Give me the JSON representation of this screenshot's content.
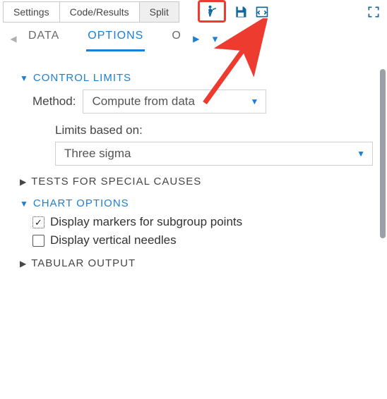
{
  "toolbar": {
    "settings": "Settings",
    "code_results": "Code/Results",
    "split": "Split"
  },
  "tabs": {
    "data": "DATA",
    "options": "OPTIONS",
    "truncated": "O"
  },
  "sections": {
    "control_limits": {
      "title": "CONTROL LIMITS",
      "method_label": "Method:",
      "method_value": "Compute from data",
      "limits_label": "Limits based on:",
      "limits_value": "Three sigma"
    },
    "tests_special": {
      "title": "TESTS FOR SPECIAL CAUSES"
    },
    "chart_options": {
      "title": "CHART OPTIONS",
      "display_markers": "Display markers for subgroup points",
      "display_needles": "Display vertical needles"
    },
    "tabular_output": {
      "title": "TABULAR OUTPUT"
    }
  }
}
